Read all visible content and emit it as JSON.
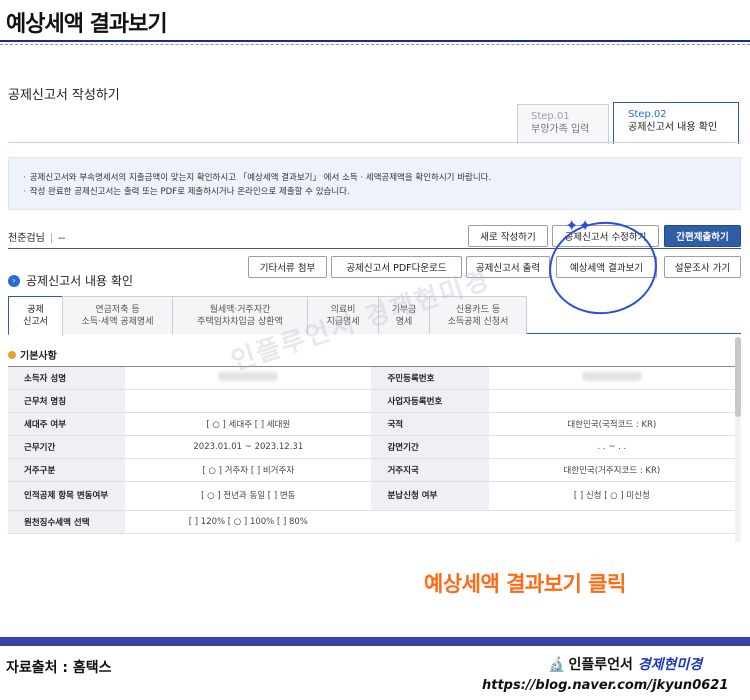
{
  "header": {
    "title": "예상세액 결과보기"
  },
  "page": {
    "title": "공제신고서 작성하기"
  },
  "steps": [
    {
      "num": "Step.01",
      "label": "부양가족 입력"
    },
    {
      "num": "Step.02",
      "label": "공제신고서 내용 확인"
    }
  ],
  "notice": [
    "공제신고서와 부속명세서의 지출금액이 맞는지 확인하시고 「예상세액 결과보기」 에서 소득 · 세액공제액을 확인하시기 바랍니다.",
    "작성 완료한 공제신고서는 출력 또는 PDF로 제출하시거나 온라인으로 제출할 수 있습니다."
  ],
  "company": {
    "name": "천준검님",
    "value": "--"
  },
  "buttons_row1": [
    "새로 작성하기",
    "공제신고서 수정하기",
    "간편제출하기"
  ],
  "buttons_row2": [
    "기타서류 첨부",
    "공제신고서 PDF다운로드",
    "공제신고서 출력",
    "예상세액 결과보기",
    "설문조사 가기"
  ],
  "section": {
    "title": "공제신고서 내용 확인"
  },
  "tabs": [
    [
      "공제",
      "신고서"
    ],
    [
      "연금저축 등",
      "소득·세액 공제명세"
    ],
    [
      "월세액·거주자간",
      "주택임차차입금 상환액"
    ],
    [
      "의료비",
      "지급명세"
    ],
    [
      "기부금",
      "명세"
    ],
    [
      "신용카드 등",
      "소득공제 신청서"
    ]
  ],
  "subheading": "기본사항",
  "table": [
    {
      "l1": "소득자 성명",
      "v1": "",
      "l2": "주민등록번호",
      "v2": ""
    },
    {
      "l1": "근무처 명칭",
      "v1": "",
      "l2": "사업자등록번호",
      "v2": ""
    },
    {
      "l1": "세대주 여부",
      "v1": "[ ○ ] 세대주  [    ] 세대원",
      "l2": "국적",
      "v2": "대한민국(국적코드 : KR)"
    },
    {
      "l1": "근무기간",
      "v1": "2023.01.01 ~ 2023.12.31",
      "l2": "감면기간",
      "v2": ". . ~ . ."
    },
    {
      "l1": "거주구분",
      "v1": "[ ○ ] 거주자  [    ] 비거주자",
      "l2": "거주지국",
      "v2": "대한민국(거주지코드 : KR)"
    },
    {
      "l1": "인적공제 항목 변동여부",
      "v1": "[ ○ ] 전년과 동일  [    ] 변동",
      "l2": "분납신청 여부",
      "v2": "[     ] 신청  [ ○ ] 미신청"
    },
    {
      "l1": "원천징수세액 선택",
      "v1": "[     ] 120%  [ ○ ] 100%  [     ] 80%",
      "l2": "",
      "v2": ""
    }
  ],
  "watermark": "인플루언서 경제현미경",
  "annotation": "예상세액 결과보기 클릭",
  "footer": {
    "source": "자료출처 : 홈택스",
    "brand_a": "인플루언서",
    "brand_b": "경제현미경",
    "url": "https://blog.naver.com/jkyun0621"
  },
  "colors": {
    "accent": "#2f5da8",
    "annotation": "#ff6a13",
    "circle": "#2d4fd8",
    "footer_bar": "#3a40a5"
  }
}
